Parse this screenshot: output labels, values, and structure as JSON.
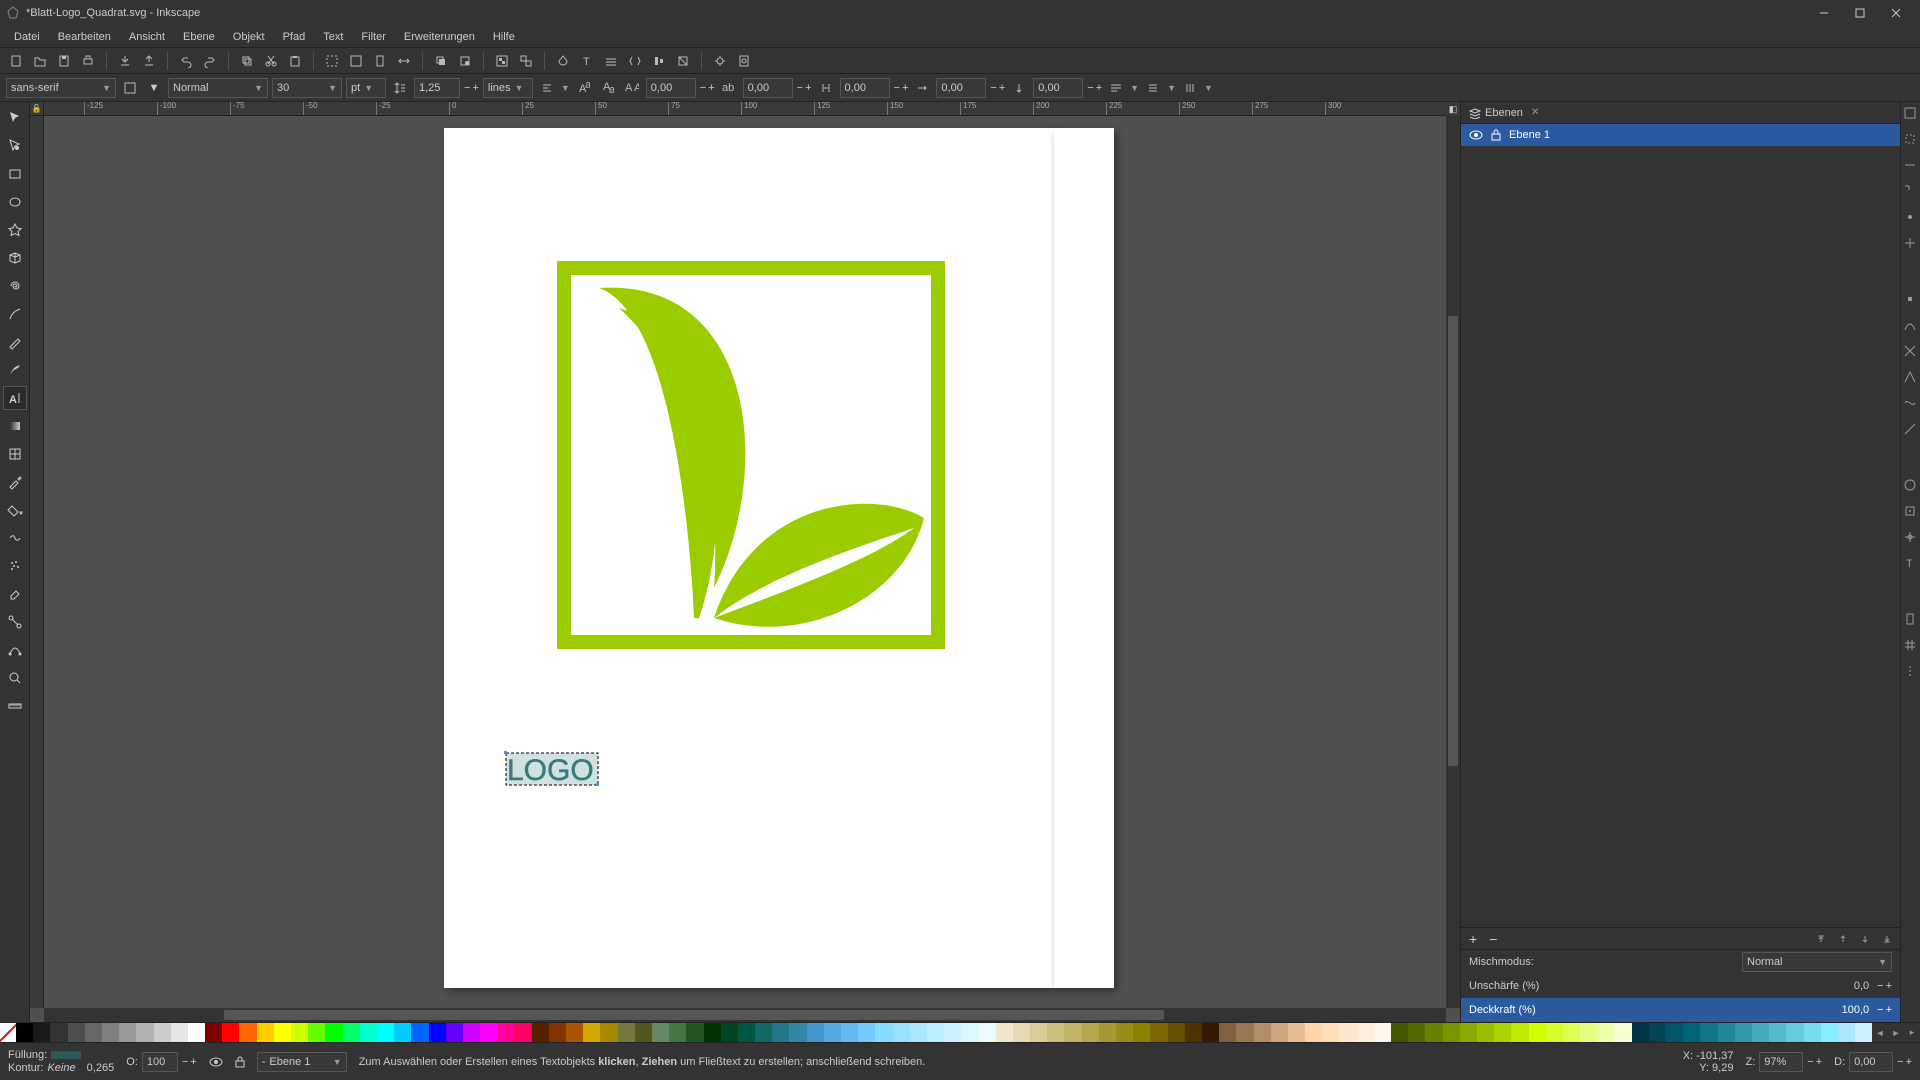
{
  "app": {
    "title": "*Blatt-Logo_Quadrat.svg - Inkscape"
  },
  "menu": {
    "items": [
      "Datei",
      "Bearbeiten",
      "Ansicht",
      "Ebene",
      "Objekt",
      "Pfad",
      "Text",
      "Filter",
      "Erweiterungen",
      "Hilfe"
    ]
  },
  "text_toolbar": {
    "font_family": "sans-serif",
    "font_style": "Normal",
    "font_size": "30",
    "unit": "pt",
    "line_height": "1,25",
    "line_unit": "lines",
    "letter_spacing": "0,00",
    "word_spacing": "0,00",
    "kerning": "0,00",
    "dx": "0,00",
    "dy": "0,00"
  },
  "ruler": {
    "labels": [
      "-125",
      "-100",
      "-75",
      "-50",
      "-25",
      "0",
      "25",
      "50",
      "75",
      "100",
      "125",
      "150",
      "175",
      "200",
      "225",
      "250",
      "275",
      "300"
    ]
  },
  "canvas_text": {
    "logo": "LOGO"
  },
  "layers": {
    "panel_title": "Ebenen",
    "items": [
      {
        "name": "Ebene 1",
        "visible": true,
        "locked": false,
        "selected": true
      }
    ],
    "blendmode_label": "Mischmodus:",
    "blendmode": "Normal",
    "blur_label": "Unschärfe (%)",
    "blur": "0,0",
    "opacity_label": "Deckkraft (%)",
    "opacity": "100,0"
  },
  "status": {
    "fill_label": "Füllung:",
    "stroke_label": "Kontur:",
    "stroke_value": "Keine",
    "stroke_width": "0,265",
    "opacity_label": "O:",
    "opacity": "100",
    "layer_prefix": "-",
    "layer": "Ebene 1",
    "message_prefix": "Zum Auswählen oder Erstellen eines Textobjekts ",
    "message_bold1": "klicken",
    "message_mid": ", ",
    "message_bold2": "Ziehen",
    "message_suffix": " um Fließtext zu erstellen; anschließend schreiben.",
    "coord_x_label": "X:",
    "coord_x": "-101,37",
    "coord_y_label": "Y:",
    "coord_y": "9,29",
    "zoom_label": "Z:",
    "zoom": "97%",
    "rotation_label": "D:",
    "rotation": "0,00"
  },
  "palette_colors": [
    "#000000",
    "#1a1a1a",
    "#333333",
    "#4d4d4d",
    "#666666",
    "#808080",
    "#999999",
    "#b3b3b3",
    "#cccccc",
    "#e6e6e6",
    "#ffffff",
    "#800000",
    "#ff0000",
    "#ff6600",
    "#ffcc00",
    "#ffff00",
    "#ccff00",
    "#66ff00",
    "#00ff00",
    "#00ff66",
    "#00ffcc",
    "#00ffff",
    "#00ccff",
    "#0066ff",
    "#0000ff",
    "#6600ff",
    "#cc00ff",
    "#ff00ff",
    "#ff0099",
    "#ff0066",
    "#552200",
    "#803300",
    "#aa5500",
    "#d4aa00",
    "#aa8800",
    "#777744",
    "#555522",
    "#668866",
    "#447744",
    "#225522",
    "#003300",
    "#004422",
    "#005544",
    "#116666",
    "#227788",
    "#3388aa",
    "#4499cc",
    "#55aadd",
    "#66bbee",
    "#77ccff",
    "#88ddff",
    "#99dfff",
    "#aae6ff",
    "#bbeeff",
    "#ccf3ff",
    "#ddf7ff",
    "#eef9ff",
    "#f2e6cc",
    "#e6d9b3",
    "#d9cc99",
    "#ccbf80",
    "#bfb366",
    "#b3a64d",
    "#a69933",
    "#998c1a",
    "#8c8000",
    "#806600",
    "#664d00",
    "#4d3300",
    "#331a00",
    "#806040",
    "#997755",
    "#b38e6b",
    "#cca680",
    "#e6bd95",
    "#ffd4aa",
    "#ffddbb",
    "#ffe6cc",
    "#ffeedd",
    "#fff7ee",
    "#445500",
    "#556b00",
    "#668000",
    "#779500",
    "#88aa00",
    "#99bf00",
    "#aad400",
    "#bbea00",
    "#ccff00",
    "#d4ff2a",
    "#ddff55",
    "#e6ff80",
    "#eeffaa",
    "#f7ffd4",
    "#003344",
    "#004455",
    "#005566",
    "#006677",
    "#117788",
    "#228899",
    "#3399aa",
    "#44aabb",
    "#55bbcc",
    "#66ccdd",
    "#77ddee",
    "#88eeff",
    "#aae6ff",
    "#ccf2ff"
  ]
}
